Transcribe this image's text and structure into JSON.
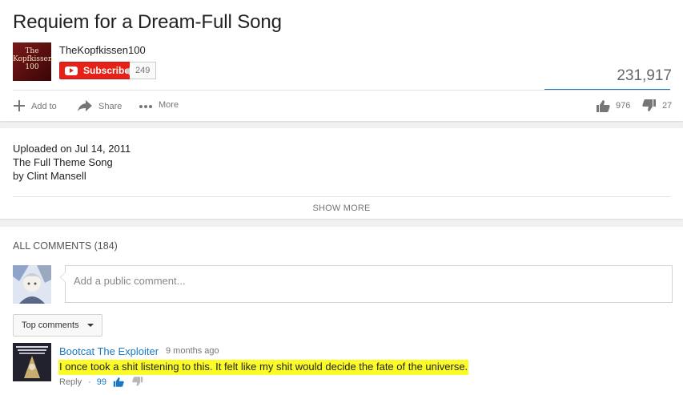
{
  "video": {
    "title": "Requiem for a Dream-Full Song",
    "channel_name": "TheKopfkissen100",
    "channel_avatar_text": "The Kopfkissen 100",
    "subscribe_label": "Subscribe",
    "subscriber_count": "249",
    "view_count": "231,917",
    "actions": {
      "add_to": "Add to",
      "share": "Share",
      "more": "More"
    },
    "likes": "976",
    "dislikes": "27"
  },
  "description": {
    "uploaded": "Uploaded on Jul 14, 2011",
    "line_1": "The Full Theme Song",
    "line_2": "by Clint Mansell",
    "show_more": "SHOW MORE"
  },
  "comments": {
    "heading": "ALL COMMENTS (184)",
    "input_placeholder": "Add a public comment...",
    "sort_label": "Top comments",
    "items": [
      {
        "author": "Bootcat The Exploiter",
        "time": "9 months ago",
        "text": "I once took a shit listening to this. It felt like my shit would decide the fate of the universe.",
        "reply_label": "Reply",
        "separator": "·",
        "likes": "99"
      }
    ]
  },
  "colors": {
    "subscribe_red": "#e62117",
    "link_blue": "#167ac6",
    "highlight_yellow": "#fbfb2a"
  }
}
